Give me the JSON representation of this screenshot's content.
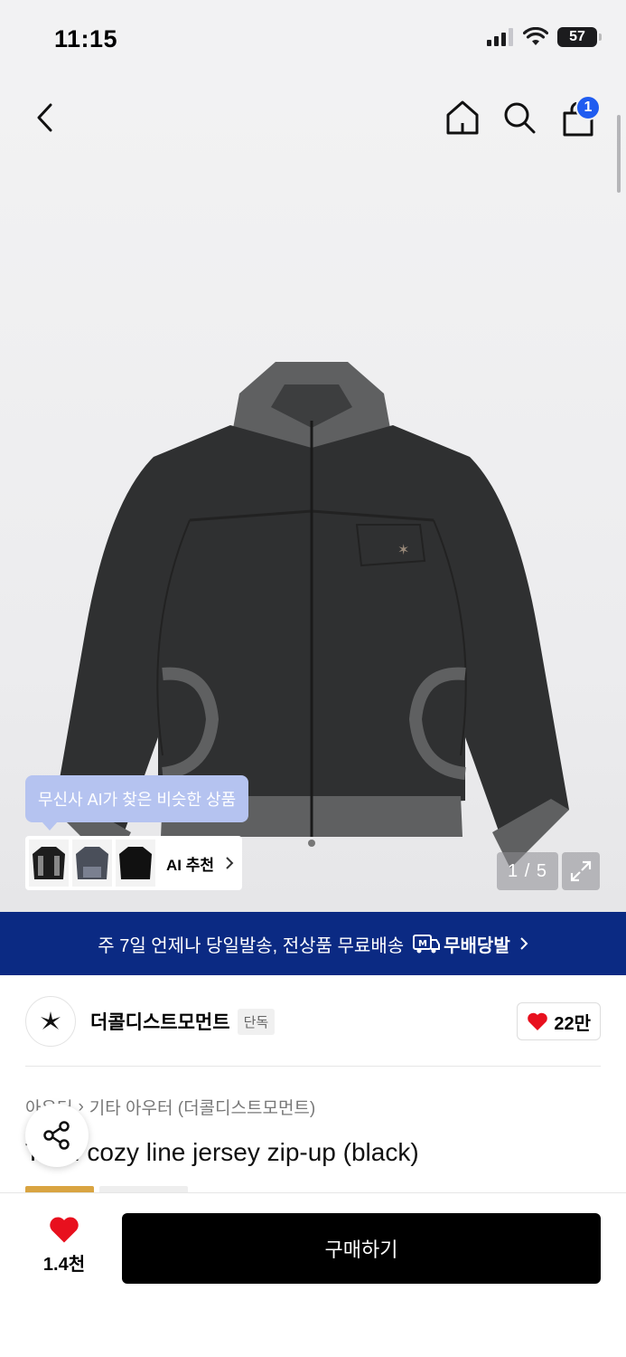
{
  "status_bar": {
    "time": "11:15",
    "battery": "57"
  },
  "header": {
    "cart_badge": "1",
    "back_icon": "chevron-left-icon",
    "home_icon": "home-icon",
    "search_icon": "search-icon",
    "cart_icon": "shopping-bag-icon"
  },
  "gallery": {
    "ai_bubble": "무신사 AI가 찾은 비슷한 상품",
    "ai_rec_label": "AI 추천",
    "page_indicator": "1 / 5"
  },
  "delivery_banner": {
    "text": "주 7일 언제나 당일발송, 전상품 무료배송",
    "brand": "무배당발"
  },
  "brand": {
    "name": "더콜디스트모먼트",
    "tag": "단독",
    "likes": "22만"
  },
  "breadcrumb": {
    "category": "아우터",
    "subcategory": "기타 아우터 (더콜디스트모먼트)"
  },
  "product": {
    "title": "TCM cozy line jersey zip-up (black)"
  },
  "bottom_bar": {
    "wish_count": "1.4천",
    "buy_label": "구매하기"
  },
  "colors": {
    "accent_blue": "#1f5cf0",
    "banner_navy": "#0b2a83",
    "heart_red": "#e8101e"
  }
}
